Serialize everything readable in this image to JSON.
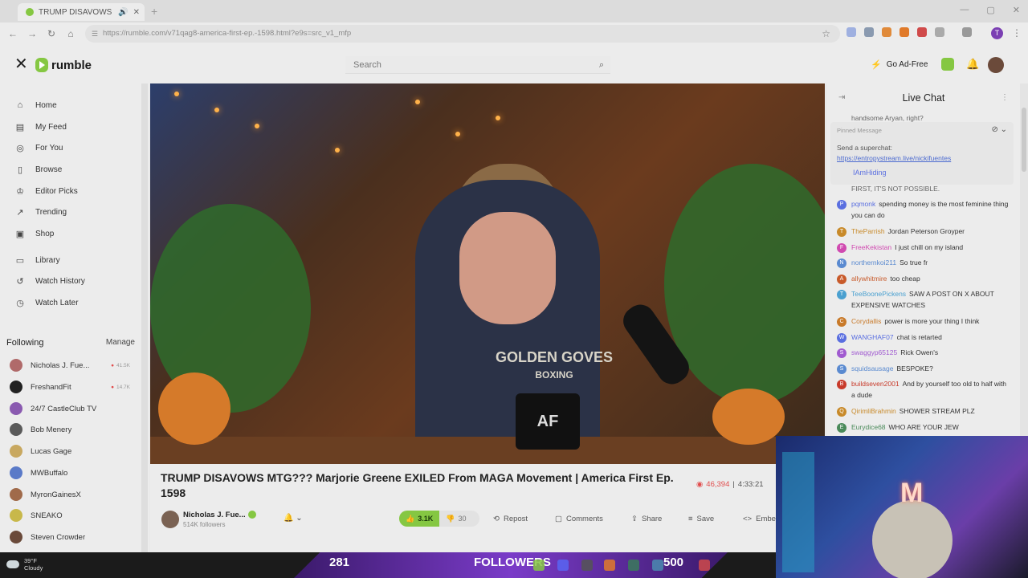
{
  "browser": {
    "tab_title": "TRUMP DISAVOWS MTG??",
    "url": "https://rumble.com/v71qag8-america-first-ep.-1598.html?e9s=src_v1_mfp"
  },
  "header": {
    "logo": "rumble",
    "search_placeholder": "Search",
    "go_adfree": "Go Ad-Free"
  },
  "sidebar": {
    "nav": [
      "Home",
      "My Feed",
      "For You",
      "Browse",
      "Editor Picks",
      "Trending",
      "Shop",
      "Library",
      "Watch History",
      "Watch Later"
    ],
    "following_title": "Following",
    "manage": "Manage",
    "following": [
      {
        "name": "Nicholas J. Fue...",
        "live": "41.5K",
        "color": "#b06a6a"
      },
      {
        "name": "FreshandFit",
        "live": "14.7K",
        "color": "#222222"
      },
      {
        "name": "24/7 CastleClub TV",
        "live": "",
        "color": "#8a5ab0"
      },
      {
        "name": "Bob Menery",
        "live": "",
        "color": "#5a5a5a"
      },
      {
        "name": "Lucas Gage",
        "live": "",
        "color": "#c8a860"
      },
      {
        "name": "MWBuffalo",
        "live": "",
        "color": "#5a7ac8"
      },
      {
        "name": "MyronGainesX",
        "live": "",
        "color": "#a06a4a"
      },
      {
        "name": "SNEAKO",
        "live": "",
        "color": "#c8b84a"
      },
      {
        "name": "Steven Crowder",
        "live": "",
        "color": "#6a4a3a"
      }
    ]
  },
  "video": {
    "title": "TRUMP DISAVOWS MTG??? Marjorie Greene EXILED From MAGA Movement | America First Ep. 1598",
    "views": "46,394",
    "duration": "4:33:21",
    "mug_text": "AF",
    "hoodie_text_1": "GOLDEN GOVES",
    "hoodie_text_2": "BOXING"
  },
  "channel": {
    "name": "Nicholas J. Fue...",
    "followers": "514K followers"
  },
  "actions": {
    "likes": "3.1K",
    "dislikes": "30",
    "repost": "Repost",
    "comments": "Comments",
    "share": "Share",
    "save": "Save",
    "embed": "Embe"
  },
  "chat": {
    "title": "Live Chat",
    "top_text": "handsome Aryan, right?",
    "pinned_label": "Pinned Message",
    "pinned_msg_prefix": "Send a superchat: ",
    "pinned_link": "https://entropystream.live/nickifuentes",
    "pinned_user": "IAmHiding",
    "trunc_text": "FIRST, IT'S NOT POSSIBLE.",
    "messages": [
      {
        "user": "pqmonk",
        "text": "spending money is the most feminine thing you can do",
        "color": "#5a6fe0",
        "lines": 2
      },
      {
        "user": "TheParrish",
        "text": "Jordan Peterson Groyper",
        "color": "#c88a2a",
        "lines": 1
      },
      {
        "user": "FreeKekistan",
        "text": "I just chill on my island",
        "color": "#d04ab0",
        "lines": 1
      },
      {
        "user": "northernkoi211",
        "text": "So true fr",
        "color": "#5a8ad0",
        "lines": 1
      },
      {
        "user": "allywhitmire",
        "text": "too cheap",
        "color": "#c85a2a",
        "lines": 1
      },
      {
        "user": "TeeBoonePickens",
        "text": "SAW A POST ON X ABOUT EXPENSIVE WATCHES",
        "color": "#4aa0d0",
        "lines": 2
      },
      {
        "user": "Corydallis",
        "text": "power is more your thing I think",
        "color": "#c87a2a",
        "lines": 1
      },
      {
        "user": "WANGHAF07",
        "text": "chat is retarted",
        "color": "#5a6fe0",
        "lines": 1
      },
      {
        "user": "swaggyp65125",
        "text": "Rick Owen's",
        "color": "#a05ad0",
        "lines": 1
      },
      {
        "user": "squidsausage",
        "text": "BESPOKE?",
        "color": "#5a8ad0",
        "lines": 1
      },
      {
        "user": "buildseven2001",
        "text": "And by yourself too old to half with a dude",
        "color": "#c83a2a",
        "lines": 2
      },
      {
        "user": "QirimliBrahmin",
        "text": "SHOWER STREAM PLZ",
        "color": "#c88a2a",
        "lines": 1
      },
      {
        "user": "Eurydice68",
        "text": "WHO ARE YOUR JEW",
        "color": "#4a8a5a",
        "lines": 1
      }
    ]
  },
  "stream_overlay": {
    "left_count": "281",
    "label": "FOLLOWERS",
    "right_count": "500",
    "cam_letter": "M"
  },
  "taskbar": {
    "temp": "39°F",
    "condition": "Cloudy"
  },
  "colors": {
    "accent": "#85c742",
    "live": "#e14b4b",
    "overlay": "#7a3bc8"
  }
}
